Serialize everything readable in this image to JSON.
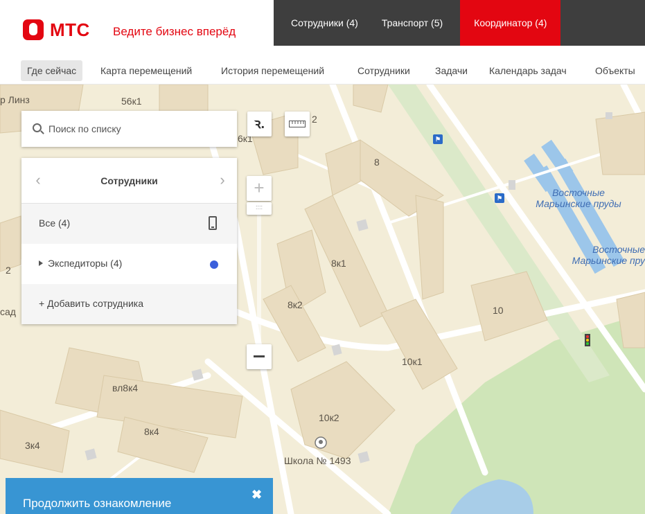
{
  "header": {
    "logo_text": "МТС",
    "slogan": "Ведите бизнес вперёд",
    "tabs": [
      {
        "label": "Сотрудники (4)"
      },
      {
        "label": "Транспорт (5)"
      },
      {
        "label": "Координатор (4)"
      }
    ],
    "accent_color": "#e30611"
  },
  "subnav": {
    "items": [
      {
        "label": "Где сейчас"
      },
      {
        "label": "Карта перемещений"
      },
      {
        "label": "История перемещений"
      },
      {
        "label": "Сотрудники"
      },
      {
        "label": "Задачи"
      },
      {
        "label": "Календарь задач"
      },
      {
        "label": "Объекты"
      }
    ]
  },
  "search": {
    "placeholder": "Поиск по списку"
  },
  "panel": {
    "title": "Сотрудники",
    "all_label": "Все (4)",
    "group_label": "Экспедиторы (4)",
    "add_label": "+ Добавить сотрудника",
    "group_dot_color": "#3b5fdb"
  },
  "map": {
    "labels": {
      "l1": "р Линз",
      "l2": "56к1",
      "l3": "6к1",
      "l4": "2",
      "l5": "8",
      "l6": "8к1",
      "l7": "8к2",
      "l8": "10",
      "l9": "10к1",
      "l10": "вл8к4",
      "l11": "8к4",
      "l12": "10к2",
      "l13": "3к4",
      "l14": "Школа № 1493",
      "l15": "2",
      "l16": "сад"
    },
    "water_1": "Восточные Марьинские пруды",
    "water_2": "Восточные Марьинские пру"
  },
  "toast": {
    "text": "Продолжить ознакомление",
    "close": "✖"
  }
}
